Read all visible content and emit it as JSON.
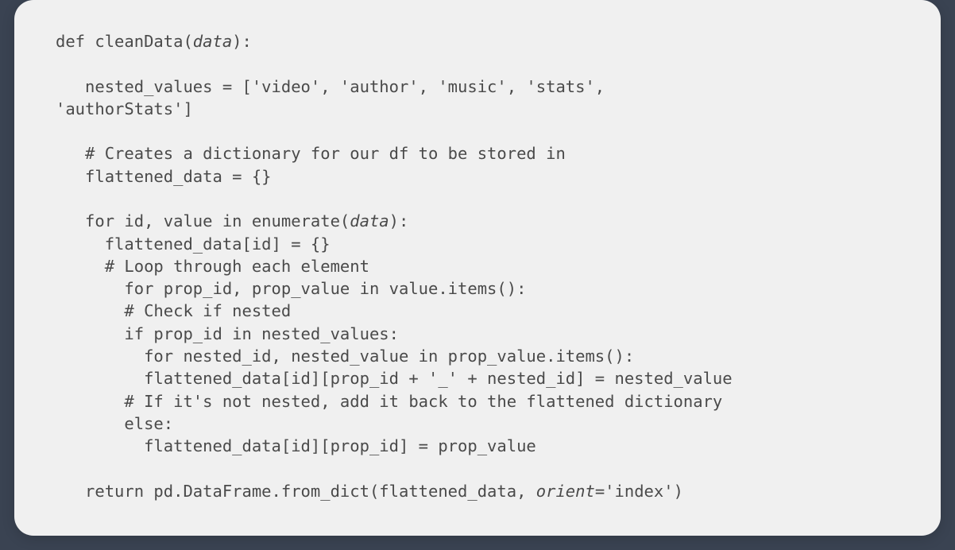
{
  "code": {
    "l01": "def cleanData(",
    "l01_it": "data",
    "l01b": "):",
    "l02": "",
    "l03": "   nested_values = ['video', 'author', 'music', 'stats',",
    "l04": "'authorStats']",
    "l05": "",
    "l06": "   # Creates a dictionary for our df to be stored in",
    "l07": "   flattened_data = {}",
    "l08": "",
    "l09": "   for id, value in enumerate(",
    "l09_it": "data",
    "l09b": "):",
    "l10": "     flattened_data[id] = {}",
    "l11": "     # Loop through each element",
    "l12": "       for prop_id, prop_value in value.items():",
    "l13": "       # Check if nested",
    "l14": "       if prop_id in nested_values:",
    "l15": "         for nested_id, nested_value in prop_value.items():",
    "l16": "         flattened_data[id][prop_id + '_' + nested_id] = nested_value",
    "l17": "       # If it's not nested, add it back to the flattened dictionary",
    "l18": "       else:",
    "l19": "         flattened_data[id][prop_id] = prop_value",
    "l20": "",
    "l21": "   return pd.DataFrame.from_dict(flattened_data, ",
    "l21_it": "orient",
    "l21b": "='index')"
  }
}
